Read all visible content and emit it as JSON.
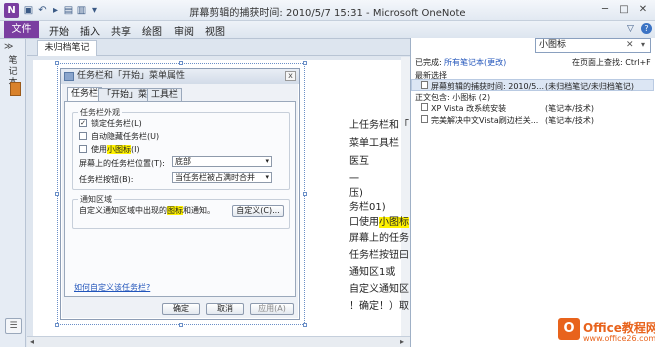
{
  "window": {
    "title": "屏幕剪辑的捕获时间: 2010/5/7 15:31 - Microsoft OneNote",
    "app_logo": "N",
    "min": "─",
    "max": "□",
    "close": "✕",
    "help": "?",
    "ribbon_toggle": "▽"
  },
  "quick_access": [
    "save-icon",
    "undo-icon",
    "redo-icon",
    "view-icon",
    "dock-icon",
    "customize-icon"
  ],
  "ribbon": {
    "file": "文件",
    "tabs": [
      "开始",
      "插入",
      "共享",
      "绘图",
      "审阅",
      "视图"
    ]
  },
  "sidebar": {
    "label": "笔记本",
    "bottom_icon": "☰"
  },
  "section_tab": "未归档笔记",
  "dialog": {
    "title": "任务栏和「开始」菜单属性",
    "close": "x",
    "tabs": [
      "任务栏",
      "「开始」菜单",
      "工具栏"
    ],
    "appearance_title": "任务栏外观",
    "lock_label": "锁定任务栏(L)",
    "autohide_label": "自动隐藏任务栏(U)",
    "small_icons_pre": "使用",
    "small_icons_hl": "小图标",
    "small_icons_post": "(I)",
    "location_label": "屏幕上的任务栏位置(T):",
    "location_value": "底部",
    "buttons_label": "任务栏按钮(B):",
    "buttons_value": "当任务栏被占满时合并",
    "notify_title": "通知区域",
    "notify_pre": "自定义通知区域中出现的",
    "notify_hl": "图标",
    "notify_post": "和通知。",
    "customize_btn": "自定义(C)...",
    "help_link": "如何自定义该任务栏?",
    "ok": "确定",
    "cancel": "取消",
    "apply": "应用(A)"
  },
  "page_lines": [
    "上任务栏和「",
    "菜单工具栏",
    "医互",
    "一",
    "压)",
    "务栏01)",
    "口使用",
    "屏幕上的任务",
    "任务栏按钮曰",
    "通知区1或",
    "自定义通知区",
    "！确定！）取"
  ],
  "page_highlight": "小图标",
  "search": {
    "value": "小图标",
    "clear": "✕",
    "dropdown": "▾",
    "status_label": "已完成:",
    "scope": "所有笔记本(更改)",
    "find_on_page": "在页面上查找: Ctrl+F",
    "recent_label": "最新选择",
    "recent_title": "屏幕剪辑的捕获时间: 2010/5...",
    "recent_loc": "(未归档笔记/未归档笔记)",
    "body_label": "正文包含: 小图标 (2)",
    "results": [
      {
        "title": "XP Vista 改系统安装",
        "loc": "(笔记本/技术)"
      },
      {
        "title": "完美解决中文Vista刷边栏关...",
        "loc": "(笔记本/技术)"
      }
    ]
  },
  "watermark": {
    "logo": "O",
    "text": "Office教程网",
    "sub": "www.office26.com"
  },
  "colors": {
    "accent": "#7a3ea0",
    "highlight": "#fff200",
    "watermark": "#e8631c"
  }
}
